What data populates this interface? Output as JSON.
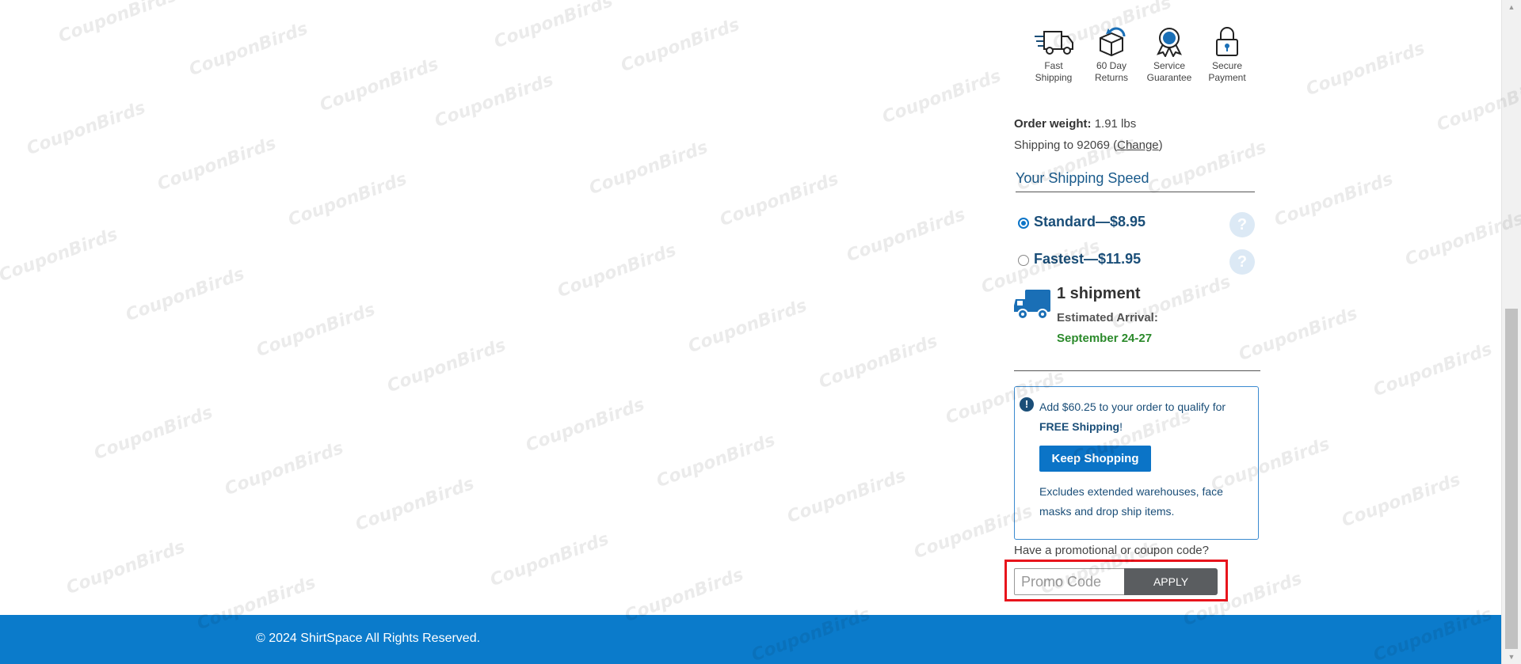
{
  "benefits": [
    {
      "icon": "fast-shipping-truck-icon",
      "line1": "Fast",
      "line2": "Shipping"
    },
    {
      "icon": "returns-box-icon",
      "line1": "60 Day",
      "line2": "Returns"
    },
    {
      "icon": "service-ribbon-icon",
      "line1": "Service",
      "line2": "Guarantee"
    },
    {
      "icon": "padlock-icon",
      "line1": "Secure",
      "line2": "Payment"
    }
  ],
  "order": {
    "weight_label": "Order weight:",
    "weight_value": "1.91 lbs",
    "shipping_to_text": "Shipping to 92069 (",
    "change_link": "Change",
    "shipping_to_close": ")"
  },
  "shipping_speed": {
    "title": "Your Shipping Speed",
    "options": [
      {
        "label": "Standard—$8.95",
        "selected": true
      },
      {
        "label": "Fastest—$11.95",
        "selected": false
      }
    ],
    "help_glyph": "?"
  },
  "shipment": {
    "count_label": "1 shipment",
    "estimated_label": "Estimated Arrival:",
    "estimated_date": "September 24-27"
  },
  "free_shipping": {
    "icon_glyph": "!",
    "message_prefix": "Add $60.25 to your order to qualify for",
    "message_bold": "FREE Shipping",
    "message_suffix": "!",
    "button_label": "Keep Shopping",
    "excludes_text": "Excludes extended warehouses, face masks and drop ship items."
  },
  "promo": {
    "question": "Have a promotional or coupon code?",
    "placeholder": "Promo Code",
    "apply_label": "APPLY"
  },
  "footer": {
    "copyright": "© 2024 ShirtSpace All Rights Reserved."
  },
  "watermark": {
    "text": "CouponBirds"
  },
  "colors": {
    "brand_blue": "#0b7bcb",
    "button_blue": "#0b74c7",
    "heading_blue": "#1a5b8c",
    "arrival_green": "#2b8a2b",
    "apply_gray": "#5a5d60",
    "highlight_red": "#e8141c"
  }
}
